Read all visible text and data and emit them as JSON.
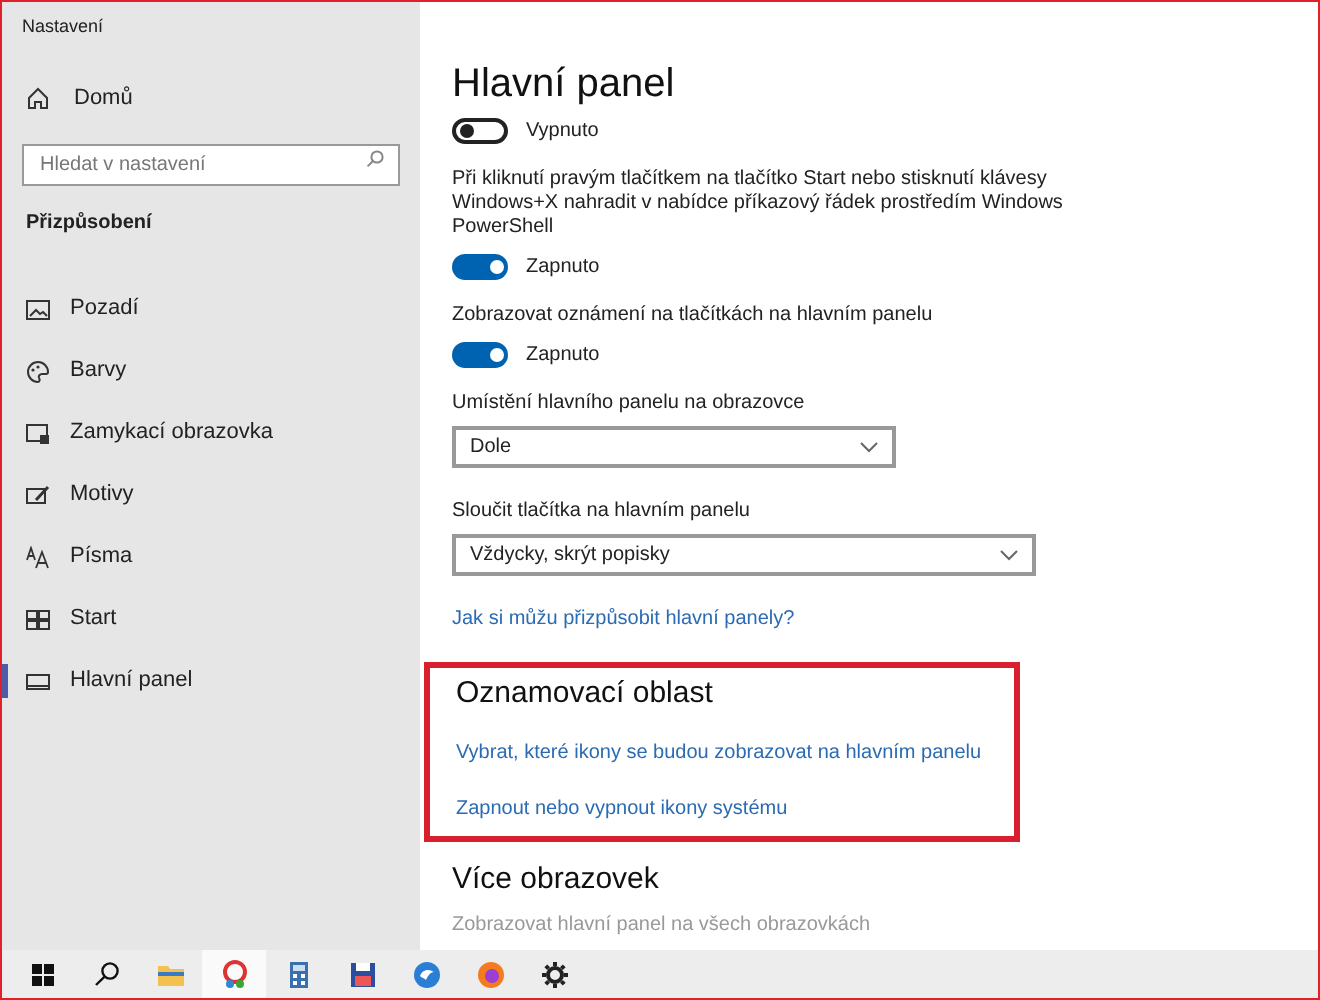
{
  "window": {
    "title": "Nastavení"
  },
  "sidebar": {
    "home": "Domů",
    "search": {
      "placeholder": "Hledat v nastavení"
    },
    "section": "Přizpůsobení",
    "items": [
      {
        "label": "Pozadí",
        "selected": false
      },
      {
        "label": "Barvy",
        "selected": false
      },
      {
        "label": "Zamykací obrazovka",
        "selected": false
      },
      {
        "label": "Motivy",
        "selected": false
      },
      {
        "label": "Písma",
        "selected": false
      },
      {
        "label": "Start",
        "selected": false
      },
      {
        "label": "Hlavní panel",
        "selected": true
      }
    ]
  },
  "content": {
    "title": "Hlavní panel",
    "settings": [
      {
        "kind": "toggle",
        "on": false,
        "state_label": "Vypnuto"
      },
      {
        "kind": "text",
        "text": "Při kliknutí pravým tlačítkem na tlačítko Start nebo stisknutí klávesy Windows+X nahradit v nabídce příkazový řádek prostředím Windows PowerShell"
      },
      {
        "kind": "toggle",
        "on": true,
        "state_label": "Zapnuto"
      },
      {
        "kind": "text",
        "text": "Zobrazovat oznámení na tlačítkách na hlavním panelu"
      },
      {
        "kind": "toggle",
        "on": true,
        "state_label": "Zapnuto"
      },
      {
        "kind": "text",
        "text": "Umístění hlavního panelu na obrazovce"
      },
      {
        "kind": "dropdown",
        "value": "Dole"
      },
      {
        "kind": "text",
        "text": "Sloučit tlačítka na hlavním panelu"
      },
      {
        "kind": "dropdown",
        "value": "Vždycky, skrýt popisky"
      },
      {
        "kind": "link",
        "text": "Jak si můžu přizpůsobit hlavní panely?"
      }
    ],
    "notification_area": {
      "title": "Oznamovací oblast",
      "highlighted": true,
      "links": [
        "Vybrat, které ikony se budou zobrazovat na hlavním panelu",
        "Zapnout nebo vypnout ikony systému"
      ]
    },
    "multiple_displays": {
      "title": "Více obrazovek",
      "setting": "Zobrazovat hlavní panel na všech obrazovkách"
    }
  },
  "taskbar": [
    {
      "active": false
    },
    {
      "active": false
    },
    {
      "active": false
    },
    {
      "active": true
    },
    {
      "active": false
    },
    {
      "active": false
    },
    {
      "active": false
    },
    {
      "active": false
    },
    {
      "active": false
    }
  ]
}
